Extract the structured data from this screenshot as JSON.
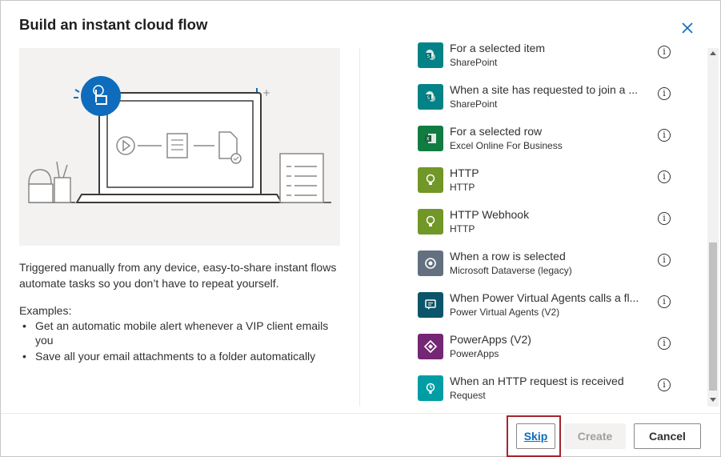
{
  "dialog": {
    "title": "Build an instant cloud flow"
  },
  "description": "Triggered manually from any device, easy-to-share instant flows automate tasks so you don’t have to repeat yourself.",
  "examples": {
    "heading": "Examples:",
    "items": [
      "Get an automatic mobile alert whenever a VIP client emails you",
      "Save all your email attachments to a folder automatically"
    ]
  },
  "triggers": [
    {
      "name": "For a selected item",
      "connector": "SharePoint",
      "icon": "sharepoint-icon",
      "color": "#038387"
    },
    {
      "name": "When a site has requested to join a ...",
      "connector": "SharePoint",
      "icon": "sharepoint-icon",
      "color": "#038387"
    },
    {
      "name": "For a selected row",
      "connector": "Excel Online For Business",
      "icon": "excel-icon",
      "color": "#107c41"
    },
    {
      "name": "HTTP",
      "connector": "HTTP",
      "icon": "http-icon",
      "color": "#709727"
    },
    {
      "name": "HTTP Webhook",
      "connector": "HTTP",
      "icon": "http-icon",
      "color": "#709727"
    },
    {
      "name": "When a row is selected",
      "connector": "Microsoft Dataverse (legacy)",
      "icon": "dataverse-icon",
      "color": "#637080"
    },
    {
      "name": "When Power Virtual Agents calls a fl...",
      "connector": "Power Virtual Agents (V2)",
      "icon": "pva-icon",
      "color": "#0b556a"
    },
    {
      "name": "PowerApps (V2)",
      "connector": "PowerApps",
      "icon": "powerapps-icon",
      "color": "#742774"
    },
    {
      "name": "When an HTTP request is received",
      "connector": "Request",
      "icon": "request-icon",
      "color": "#009da5"
    }
  ],
  "buttons": {
    "skip": "Skip",
    "create": "Create",
    "cancel": "Cancel"
  },
  "info_glyph": "i"
}
